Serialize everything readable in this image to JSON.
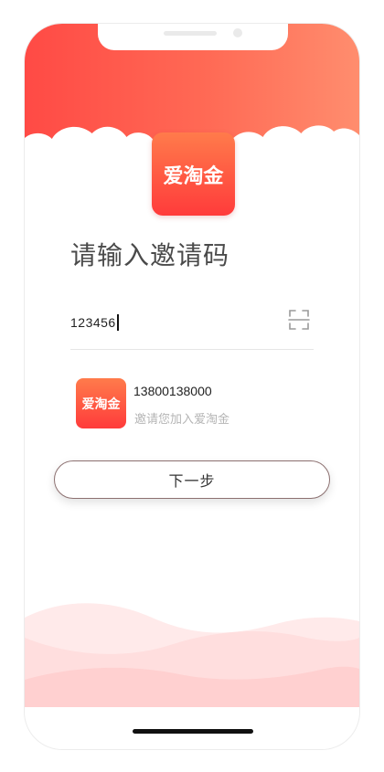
{
  "colors": {
    "brand_start": "#ff4a45",
    "brand_end": "#ff8d6e",
    "logo_gradient_top": "#ff7b4b",
    "logo_gradient_bottom": "#ff3b3b",
    "wave_pink": "#ffd6d6"
  },
  "app": {
    "logo_text": "爱淘金"
  },
  "page": {
    "title": "请输入邀请码"
  },
  "invite_input": {
    "value": "123456",
    "scan_icon": "scan-icon"
  },
  "inviter": {
    "avatar_text": "爱淘金",
    "phone": "13800138000",
    "message": "邀请您加入爱淘金"
  },
  "actions": {
    "next_label": "下一步"
  }
}
